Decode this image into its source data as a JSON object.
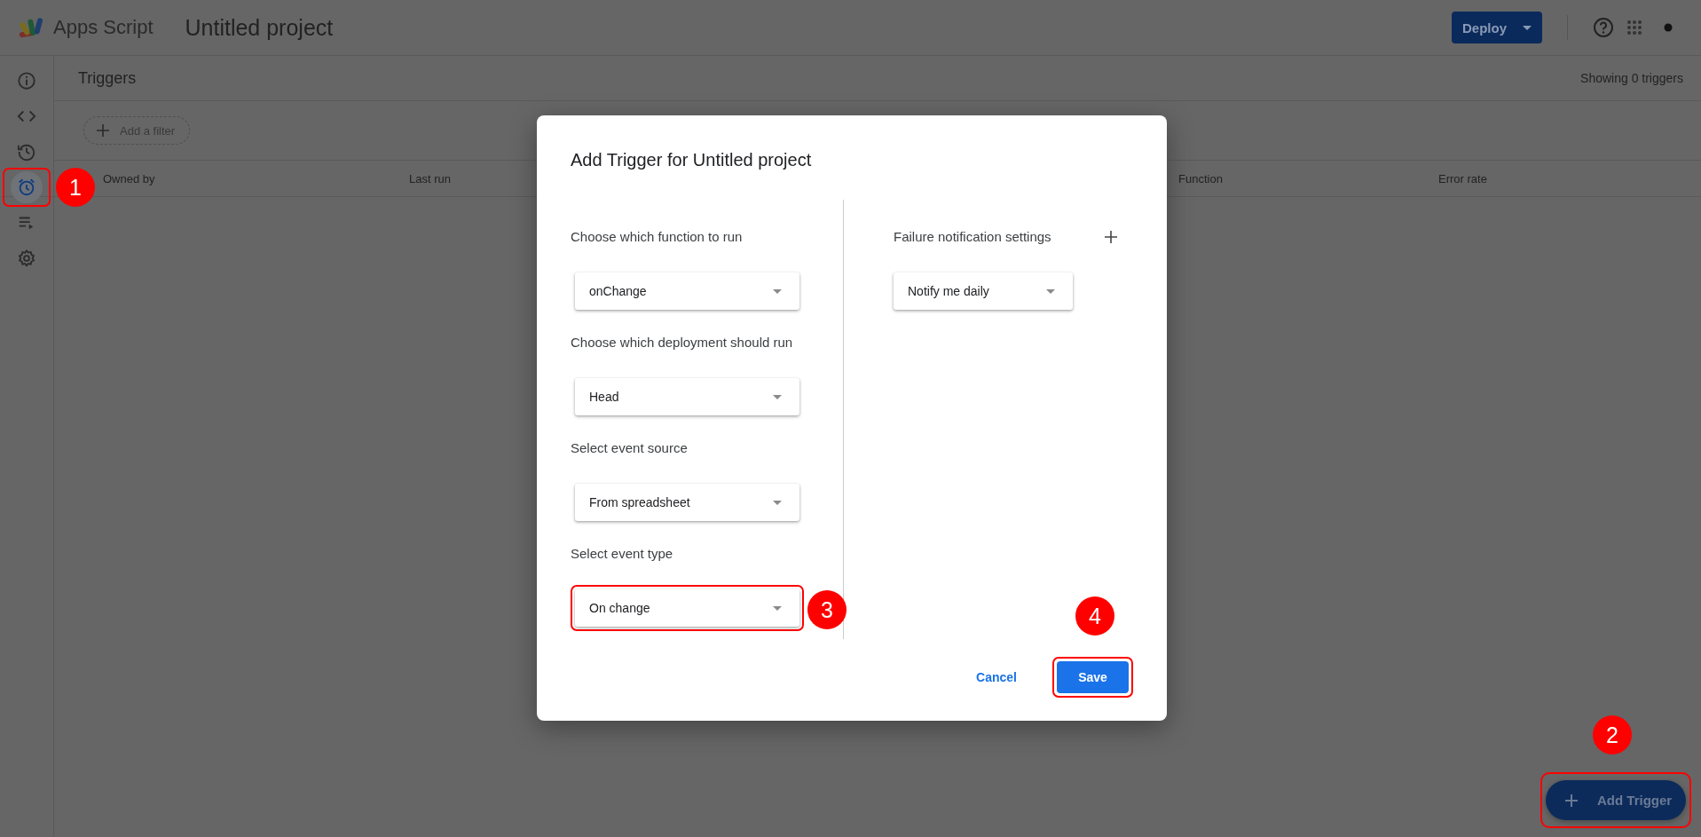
{
  "app": {
    "name": "Apps Script",
    "project": "Untitled project"
  },
  "deploy_button": {
    "label": "Deploy"
  },
  "sidebar": {
    "items": [
      {
        "kind": "info",
        "selected": false,
        "highlighted": false
      },
      {
        "kind": "code",
        "selected": false,
        "highlighted": false
      },
      {
        "kind": "history",
        "selected": false,
        "highlighted": false
      },
      {
        "kind": "triggers",
        "selected": true,
        "highlighted": true,
        "callout": "1"
      },
      {
        "kind": "executions",
        "selected": false,
        "highlighted": false
      },
      {
        "kind": "settings",
        "selected": false,
        "highlighted": false
      }
    ]
  },
  "page": {
    "title": "Triggers",
    "count": "Showing 0 triggers",
    "filter_chip": "Add a filter",
    "columns": [
      "Owned by",
      "Last run",
      "Function",
      "Error rate"
    ]
  },
  "dialog": {
    "title": "Add Trigger for Untitled project",
    "fields": [
      {
        "label": "Choose which function to run",
        "value": "onChange",
        "highlighted": false
      },
      {
        "label": "Choose which deployment should run",
        "value": "Head",
        "highlighted": false
      },
      {
        "label": "Select event source",
        "value": "From spreadsheet",
        "highlighted": false
      },
      {
        "label": "Select event type",
        "value": "On change",
        "highlighted": true,
        "callout": "3"
      }
    ],
    "failure": {
      "label": "Failure notification settings",
      "value": "Notify me daily"
    },
    "cancel": "Cancel",
    "save": {
      "label": "Save",
      "highlighted": true,
      "callout": "4"
    }
  },
  "fab": {
    "label": "Add Trigger",
    "highlighted": true,
    "callout": "2"
  }
}
